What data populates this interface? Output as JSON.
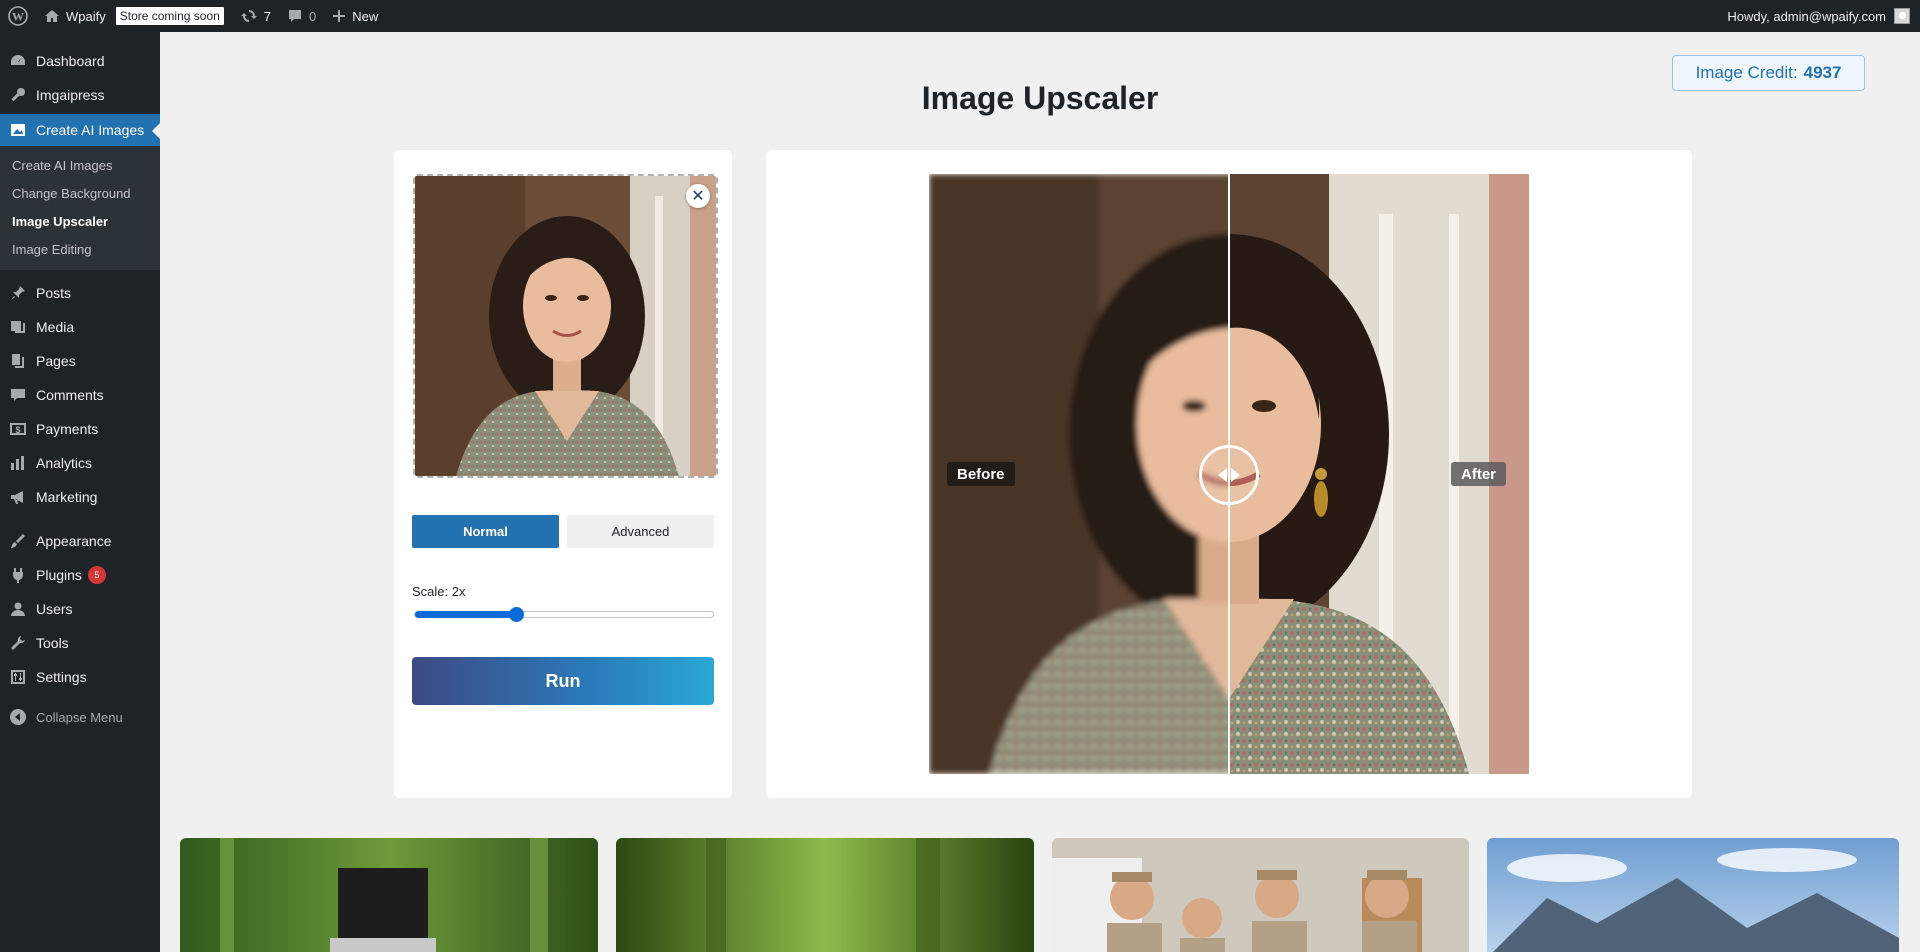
{
  "admin_bar": {
    "site_name": "Wpaify",
    "store_badge": "Store coming soon",
    "updates_count": "7",
    "comments_count": "0",
    "new_label": "New",
    "howdy": "Howdy, admin@wpaify.com"
  },
  "sidebar": {
    "items": [
      {
        "label": "Dashboard",
        "icon": "dashboard-icon"
      },
      {
        "label": "Imgaipress",
        "icon": "key-icon"
      },
      {
        "label": "Create AI Images",
        "icon": "image-icon"
      }
    ],
    "submenu": [
      {
        "label": "Create AI Images"
      },
      {
        "label": "Change Background"
      },
      {
        "label": "Image Upscaler"
      },
      {
        "label": "Image Editing"
      }
    ],
    "items2": [
      {
        "label": "Posts",
        "icon": "pin-icon"
      },
      {
        "label": "Media",
        "icon": "media-icon"
      },
      {
        "label": "Pages",
        "icon": "pages-icon"
      },
      {
        "label": "Comments",
        "icon": "comment-icon"
      },
      {
        "label": "Payments",
        "icon": "dollar-icon"
      },
      {
        "label": "Analytics",
        "icon": "bar-chart-icon"
      },
      {
        "label": "Marketing",
        "icon": "megaphone-icon"
      },
      {
        "label": "Appearance",
        "icon": "brush-icon"
      },
      {
        "label": "Plugins",
        "icon": "plug-icon",
        "badge": "5"
      },
      {
        "label": "Users",
        "icon": "user-icon"
      },
      {
        "label": "Tools",
        "icon": "wrench-icon"
      },
      {
        "label": "Settings",
        "icon": "settings-icon"
      }
    ],
    "collapse_label": "Collapse Menu"
  },
  "credit": {
    "label": "Image Credit:",
    "value": "4937"
  },
  "page_title": "Image Upscaler",
  "controls": {
    "mode_normal": "Normal",
    "mode_advanced": "Advanced",
    "active_mode": "Normal",
    "scale_label": "Scale: 2x",
    "scale_fraction": 0.34,
    "run_label": "Run"
  },
  "compare": {
    "before_label": "Before",
    "after_label": "After",
    "split_fraction": 0.5
  },
  "colors": {
    "accent": "#2271b1",
    "admin_dark": "#1d2327",
    "badge_red": "#d63638",
    "slider_blue": "#0b6bd8"
  }
}
